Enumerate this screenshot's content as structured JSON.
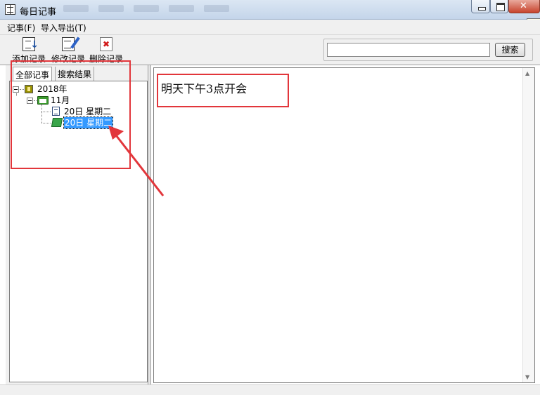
{
  "window": {
    "title": "每日记事",
    "tooltip": "关闭"
  },
  "menubar": {
    "items": [
      "记事(F)",
      "导入导出(T)"
    ]
  },
  "toolbar": {
    "add_label": "添加记录",
    "edit_label": "修改记录",
    "delete_label": "删除记录"
  },
  "search": {
    "value": "",
    "placeholder": "",
    "button_label": "搜索"
  },
  "tabs": [
    "全部记事",
    "搜索结果"
  ],
  "tree": {
    "year": "2018年",
    "month": "11月",
    "entries": [
      "20日  星期二",
      "20日  星期二"
    ],
    "selected_index": 1
  },
  "note": {
    "text": "明天下午3点开会"
  },
  "colors": {
    "annotation": "#e2363b",
    "selection": "#3399ff"
  },
  "icons": {
    "app": "notebook-icon",
    "year": "calendar-year-icon",
    "month": "folder-open-icon",
    "entry": "document-icon",
    "entry_selected": "open-book-icon"
  }
}
